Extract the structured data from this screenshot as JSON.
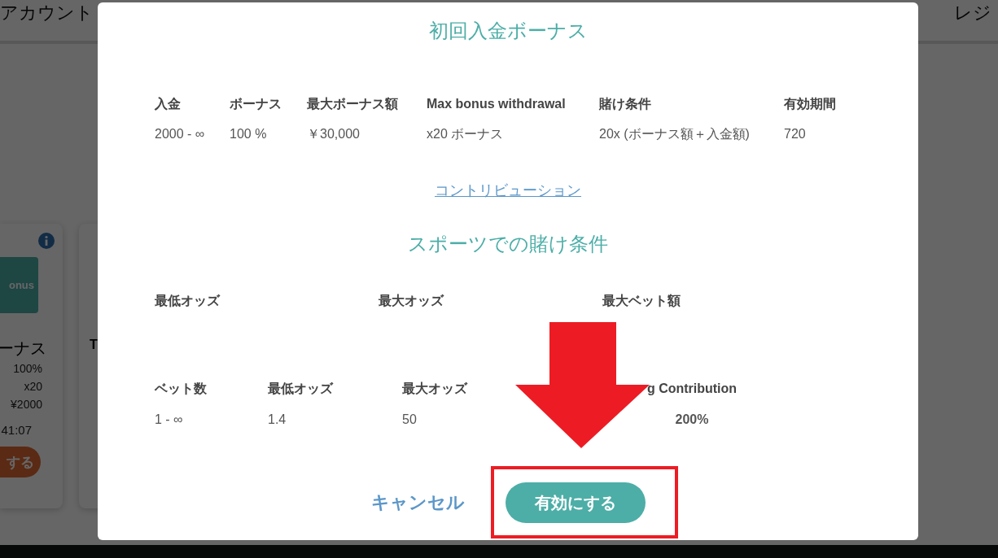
{
  "background": {
    "header": {
      "left": "アカウント",
      "right": "レジ"
    },
    "cards": [
      {
        "badge": "onus",
        "title": "ーナス",
        "rows": [
          "100%",
          "x20",
          "¥2000"
        ],
        "timer": "41:07",
        "button": "する"
      },
      {
        "title": "T"
      }
    ]
  },
  "dialog": {
    "title": "初回入金ボーナス",
    "bonus_table": {
      "columns": [
        "入金",
        "ボーナス",
        "最大ボーナス額",
        "Max bonus withdrawal",
        "賭け条件",
        "有効期間"
      ],
      "rows": [
        [
          "2000 - ∞",
          "100 %",
          "￥30,000",
          "x20 ボーナス",
          "20x (ボーナス額＋入金額)",
          "720"
        ]
      ]
    },
    "contribution_link": "コントリビューション",
    "sports_title": "スポーツでの賭け条件",
    "odds_headers": [
      "最低オッズ",
      "最大オッズ",
      "最大ベット額"
    ],
    "bets_table": {
      "columns": [
        "ベット数",
        "最低オッズ",
        "最大オッズ",
        "g Contribution"
      ],
      "rows": [
        [
          "1 - ∞",
          "1.4",
          "50",
          "200%"
        ]
      ]
    },
    "buttons": {
      "cancel": "キャンセル",
      "activate": "有効にする"
    }
  }
}
